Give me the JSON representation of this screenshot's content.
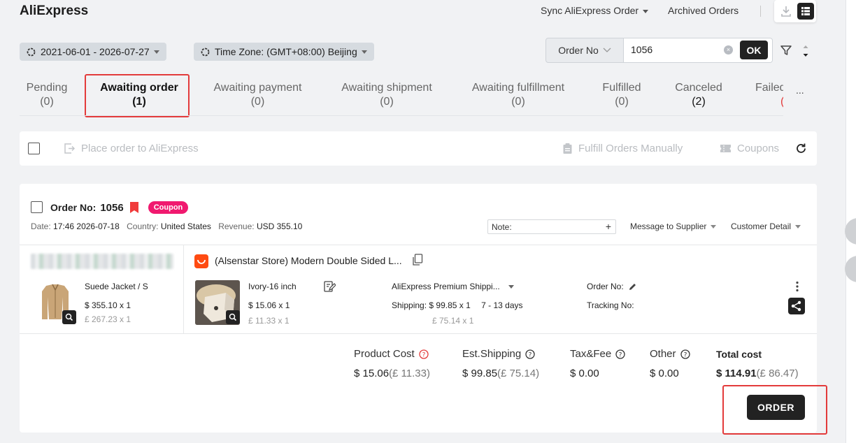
{
  "app": {
    "title": "AliExpress"
  },
  "header": {
    "sync_label": "Sync AliExpress Order",
    "archived_label": "Archived Orders"
  },
  "filters": {
    "date_range": "2021-06-01 - 2026-07-27",
    "timezone": "Time Zone: (GMT+08:00) Beijing",
    "search_type": "Order No",
    "search_value": "1056",
    "ok_label": "OK"
  },
  "tabs": [
    {
      "label": "Pending",
      "count": "(0)"
    },
    {
      "label": "Awaiting order",
      "count": "(1)"
    },
    {
      "label": "Awaiting payment",
      "count": "(0)"
    },
    {
      "label": "Awaiting shipment",
      "count": "(0)"
    },
    {
      "label": "Awaiting fulfillment",
      "count": "(0)"
    },
    {
      "label": "Fulfilled",
      "count": "(0)"
    },
    {
      "label": "Canceled",
      "count": "(2)"
    },
    {
      "label": "Failed",
      "count": "("
    }
  ],
  "tabs_more": "...",
  "actions": {
    "place_order": "Place order to AliExpress",
    "fulfill_manually": "Fulfill Orders Manually",
    "coupons": "Coupons"
  },
  "order": {
    "order_no_label": "Order No:",
    "order_no": "1056",
    "coupon_badge": "Coupon",
    "date_label": "Date:",
    "date": "17:46 2026-07-18",
    "country_label": "Country:",
    "country": "United States",
    "revenue_label": "Revenue:",
    "revenue": "USD 355.10",
    "note_label": "Note:",
    "message_supplier": "Message to Supplier",
    "customer_detail": "Customer Detail",
    "source_product": {
      "name": "Suede Jacket / S",
      "price": "$ 355.10 x 1",
      "price_sub": "£ 267.23 x 1"
    },
    "supplier": {
      "store_title": "(Alsenstar Store) Modern Double Sided L...",
      "variant": "Ivory-16 inch",
      "price": "$ 15.06 x 1",
      "price_sub": "£ 11.33 x 1",
      "shipping_method": "AliExpress Premium Shippi...",
      "shipping_label": "Shipping:",
      "shipping_price": "$ 99.85 x 1",
      "shipping_days": "7 - 13 days",
      "shipping_sub": "£ 75.14 x 1",
      "order_no_label": "Order No:",
      "tracking_label": "Tracking No:"
    },
    "costs": {
      "product_cost_label": "Product Cost",
      "product_cost": "$ 15.06",
      "product_cost_sub": "(£ 11.33)",
      "shipping_label": "Est.Shipping",
      "shipping": "$ 99.85",
      "shipping_sub": "(£ 75.14)",
      "tax_label": "Tax&Fee",
      "tax": "$ 0.00",
      "other_label": "Other",
      "other": "$ 0.00",
      "total_label": "Total cost",
      "total": "$ 114.91",
      "total_sub": "(£ 86.47)"
    },
    "order_button": "ORDER"
  },
  "colors": {
    "accent_dark": "#222222",
    "highlight_red": "#e33b3b",
    "coupon_pink": "#f0196f",
    "bookmark_red": "#f03b3b",
    "aliexpress_orange": "#ff4b12"
  }
}
